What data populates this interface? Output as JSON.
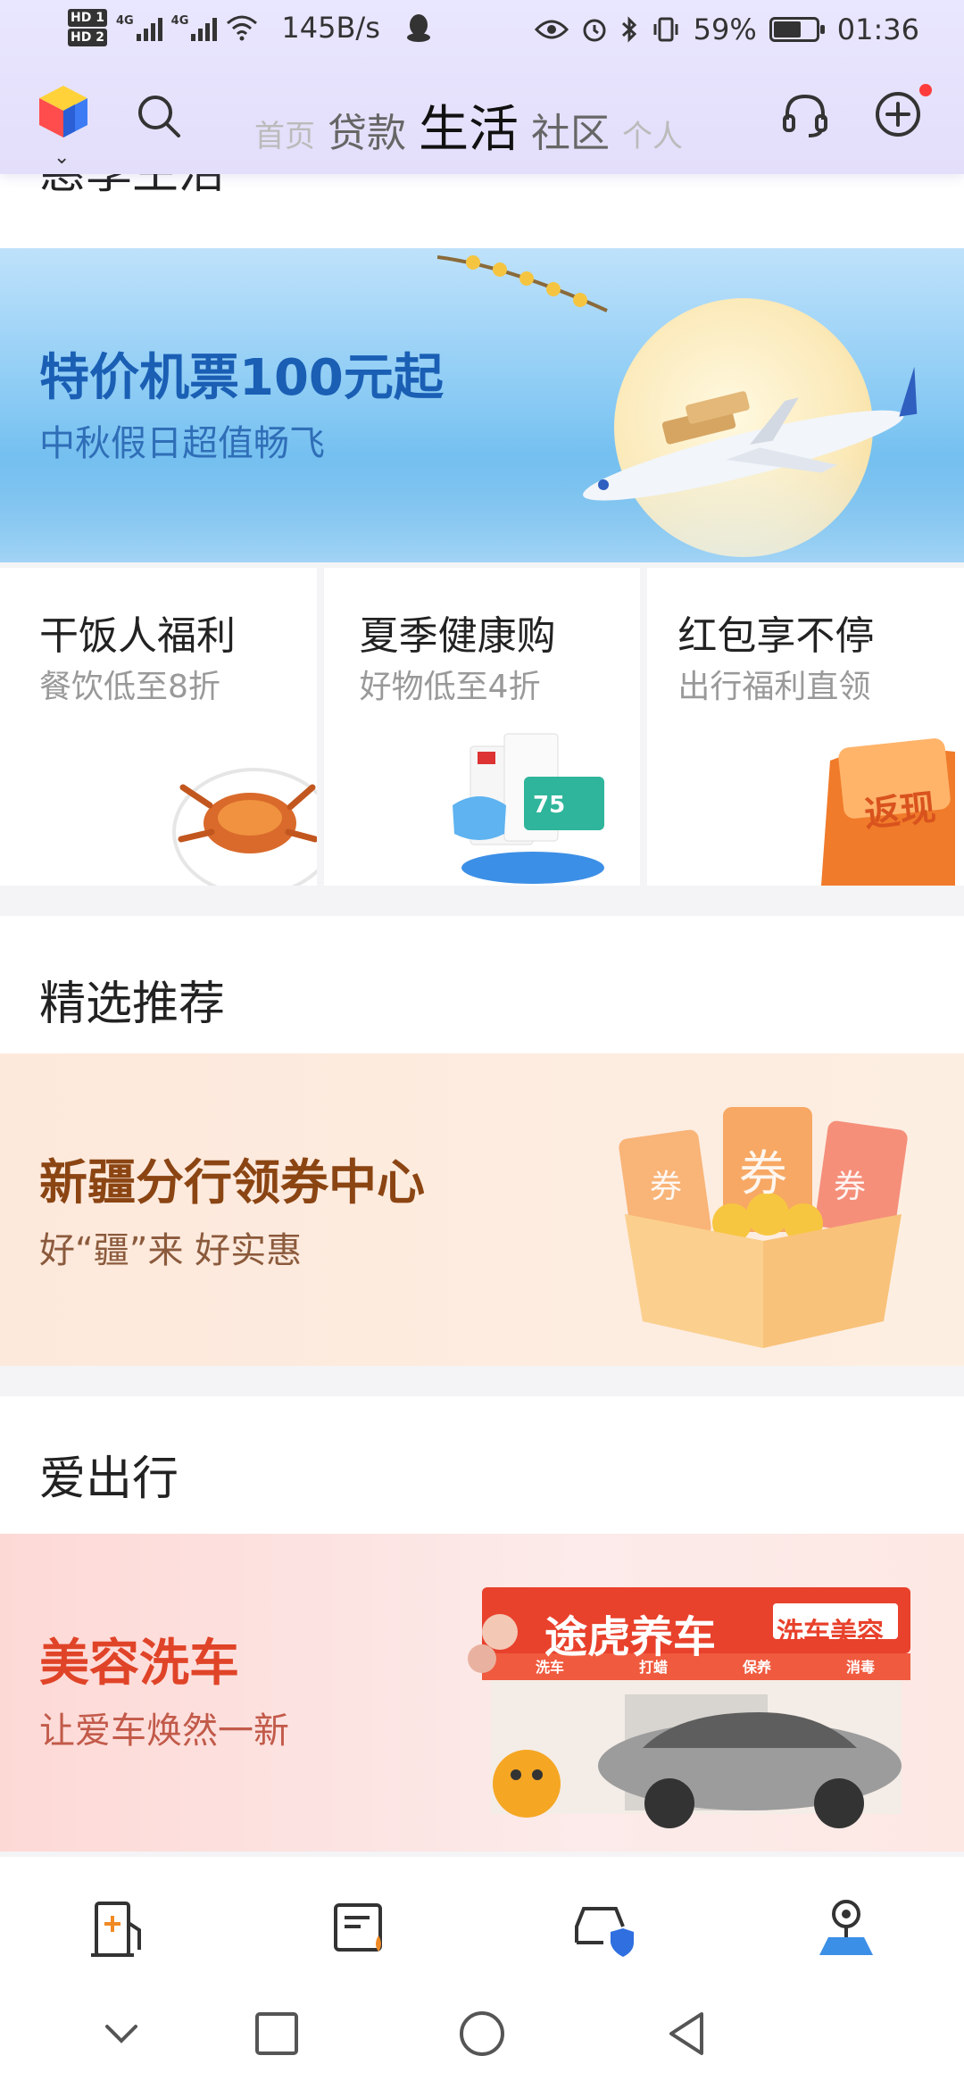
{
  "status_bar": {
    "net_speed": "145B/s",
    "battery": "59%",
    "time": "01:36",
    "sim_labels": [
      "HD 1",
      "HD 2"
    ],
    "network": [
      "4G",
      "4G"
    ]
  },
  "header": {
    "tabs": [
      "首页",
      "贷款",
      "生活",
      "社区",
      "个人"
    ],
    "active_tab": "生活"
  },
  "section_partial_title": "惠享生活",
  "flight_banner": {
    "title": "特价机票100元起",
    "subtitle": "中秋假日超值畅飞"
  },
  "promo_cards": [
    {
      "title": "干饭人福利",
      "subtitle": "餐饮低至8折",
      "icon": "crab-plate-icon"
    },
    {
      "title": "夏季健康购",
      "subtitle": "好物低至4折",
      "icon": "health-products-icon"
    },
    {
      "title": "红包享不停",
      "subtitle": "出行福利直领",
      "badge": "返现",
      "icon": "red-envelope-icon"
    }
  ],
  "recommend_section": {
    "title": "精选推荐",
    "banner_title": "新疆分行领券中心",
    "banner_subtitle": "好“疆”来 好实惠",
    "coupon_text": "券"
  },
  "travel_section": {
    "title": "爱出行",
    "banner_title": "美容洗车",
    "banner_subtitle": "让爱车焕然一新",
    "store_sign": "途虎养车",
    "store_sub_sign": "洗车美容",
    "store_services": [
      "洗车",
      "打蜡",
      "保养",
      "消毒"
    ]
  },
  "bottom_nav_icons": [
    "fuel-icon",
    "oil-receipt-icon",
    "car-shield-icon",
    "parking-map-icon"
  ],
  "system_nav": [
    "chevron-down-icon",
    "square-icon",
    "circle-home-icon",
    "back-triangle-icon"
  ],
  "colors": {
    "header_bg": "#e6e2fc",
    "flight_title": "#1a5fb4",
    "coupon_title": "#8b4513",
    "car_title": "#e04428"
  }
}
